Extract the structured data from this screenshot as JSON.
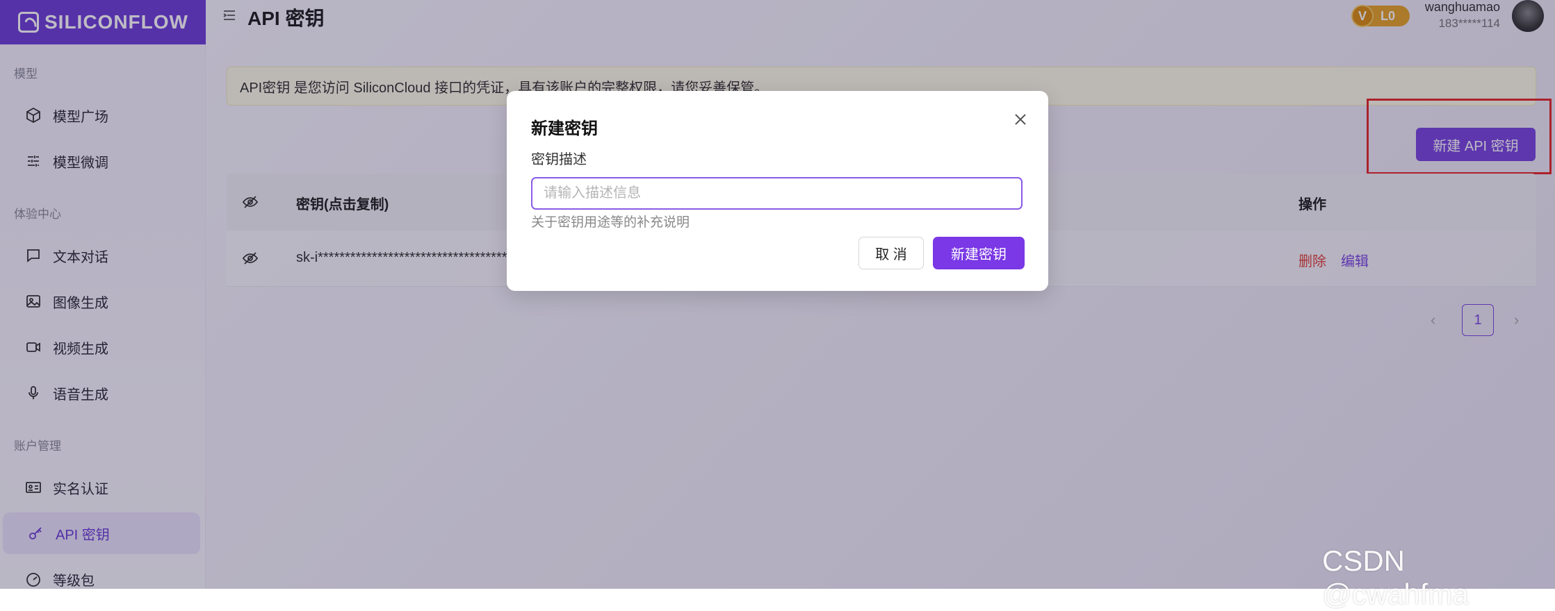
{
  "brand": {
    "logo_text": "SILICONFLOW"
  },
  "sidebar": {
    "sections": [
      {
        "label": "模型"
      },
      {
        "label": "体验中心"
      },
      {
        "label": "账户管理"
      }
    ],
    "items": [
      {
        "label": "模型广场",
        "icon": "cube-icon"
      },
      {
        "label": "模型微调",
        "icon": "sliders-icon"
      },
      {
        "label": "文本对话",
        "icon": "chat-icon"
      },
      {
        "label": "图像生成",
        "icon": "image-icon"
      },
      {
        "label": "视频生成",
        "icon": "video-icon"
      },
      {
        "label": "语音生成",
        "icon": "microphone-icon"
      },
      {
        "label": "实名认证",
        "icon": "id-card-icon"
      },
      {
        "label": "API 密钥",
        "icon": "key-icon",
        "active": true
      },
      {
        "label": "等级包",
        "icon": "gauge-icon"
      }
    ]
  },
  "header": {
    "title": "API 密钥",
    "level": "L0",
    "username": "wanghuamao",
    "phone": "183*****114"
  },
  "notice": {
    "text": "API密钥 是您访问 SiliconCloud 接口的凭证，具有该账户的完整权限，请您妥善保管。"
  },
  "toolbar": {
    "new_key_label": "新建 API 密钥"
  },
  "table": {
    "headers": {
      "key": "密钥(点击复制)",
      "actions": "操作"
    },
    "rows": [
      {
        "key": "sk-i***************************************",
        "delete": "删除",
        "edit": "编辑"
      }
    ]
  },
  "pagination": {
    "current": "1"
  },
  "modal": {
    "title": "新建密钥",
    "field_label": "密钥描述",
    "placeholder": "请输入描述信息",
    "help": "关于密钥用途等的补充说明",
    "cancel_label": "取 消",
    "create_label": "新建密钥"
  },
  "watermark": "CSDN @cwahfma",
  "colors": {
    "accent": "#7a47e0",
    "danger": "#e0443c",
    "highlight_box": "#e52a2a",
    "level_badge": "#e6a42a"
  }
}
